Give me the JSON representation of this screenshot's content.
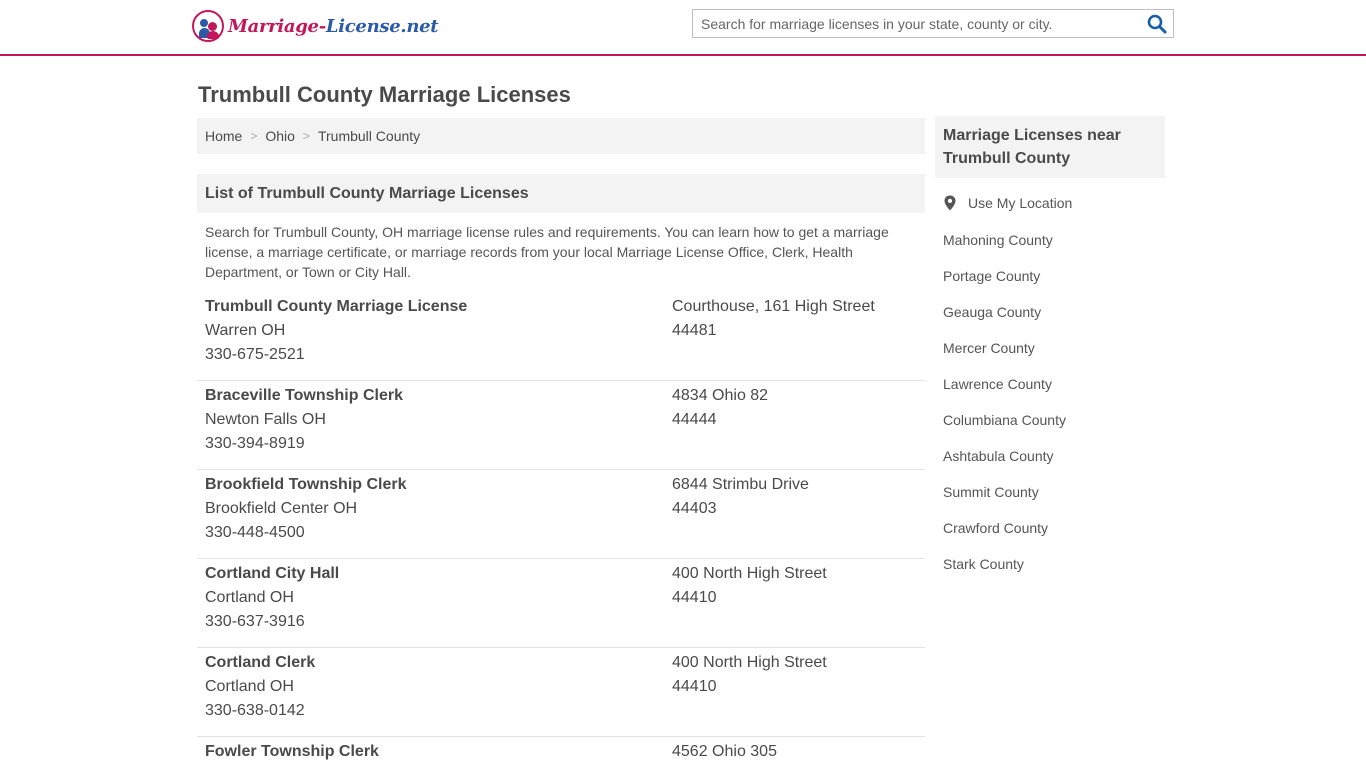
{
  "header": {
    "logo": {
      "part1": "Marriage-",
      "part2": "License.net"
    },
    "search": {
      "placeholder": "Search for marriage licenses in your state, county or city."
    }
  },
  "colors": {
    "accent": "#c2185b",
    "brand_blue": "#2b5aa8"
  },
  "page_title": "Trumbull County Marriage Licenses",
  "breadcrumb": [
    "Home",
    "Ohio",
    "Trumbull County"
  ],
  "list": {
    "heading": "List of Trumbull County Marriage Licenses",
    "intro": "Search for Trumbull County, OH marriage license rules and requirements. You can learn how to get a marriage license, a marriage certificate, or marriage records from your local Marriage License Office, Clerk, Health Department, or Town or City Hall.",
    "items": [
      {
        "name": "Trumbull County Marriage License",
        "city": "Warren OH",
        "phone": "330-675-2521",
        "address": "Courthouse, 161 High Street",
        "zip": "44481"
      },
      {
        "name": "Braceville Township Clerk",
        "city": "Newton Falls OH",
        "phone": "330-394-8919",
        "address": "4834 Ohio 82",
        "zip": "44444"
      },
      {
        "name": "Brookfield Township Clerk",
        "city": "Brookfield Center OH",
        "phone": "330-448-4500",
        "address": "6844 Strimbu Drive",
        "zip": "44403"
      },
      {
        "name": "Cortland City Hall",
        "city": "Cortland OH",
        "phone": "330-637-3916",
        "address": "400 North High Street",
        "zip": "44410"
      },
      {
        "name": "Cortland Clerk",
        "city": "Cortland OH",
        "phone": "330-638-0142",
        "address": "400 North High Street",
        "zip": "44410"
      },
      {
        "name": "Fowler Township Clerk",
        "city": "",
        "phone": "",
        "address": "4562 Ohio 305",
        "zip": ""
      }
    ]
  },
  "sidebar": {
    "heading": "Marriage Licenses near Trumbull County",
    "use_location": "Use My Location",
    "links": [
      "Mahoning County",
      "Portage County",
      "Geauga County",
      "Mercer County",
      "Lawrence County",
      "Columbiana County",
      "Ashtabula County",
      "Summit County",
      "Crawford County",
      "Stark County"
    ]
  }
}
